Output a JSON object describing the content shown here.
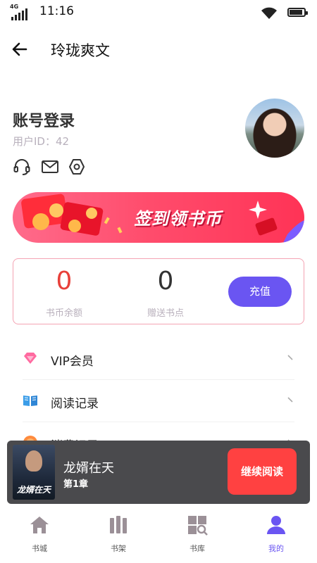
{
  "status_bar": {
    "network": "4G",
    "time": "11:16"
  },
  "nav": {
    "title": "玲珑爽文"
  },
  "profile": {
    "login_title": "账号登录",
    "user_id": "用户ID：42"
  },
  "banner": {
    "text": "签到领书币"
  },
  "wallet": {
    "balance_value": "0",
    "balance_label": "书币余额",
    "bonus_value": "0",
    "bonus_label": "赠送书点",
    "recharge_label": "充值"
  },
  "menu": [
    {
      "label": "VIP会员",
      "icon": "diamond-icon"
    },
    {
      "label": "阅读记录",
      "icon": "book-icon"
    },
    {
      "label": "消费记录",
      "icon": "coin-icon"
    }
  ],
  "player": {
    "book_title": "龙婿在天",
    "chapter": "第1章",
    "cover_text": "龙婿在天",
    "continue_label": "继续阅读"
  },
  "tabs": [
    {
      "label": "书城",
      "icon": "home-icon"
    },
    {
      "label": "书架",
      "icon": "bookshelf-icon"
    },
    {
      "label": "书库",
      "icon": "library-icon"
    },
    {
      "label": "我的",
      "icon": "user-icon",
      "active": true
    }
  ],
  "colors": {
    "accent": "#6a55f2",
    "banner": "#ff4d6d",
    "continue": "#ff4141",
    "balance": "#e8403a"
  }
}
